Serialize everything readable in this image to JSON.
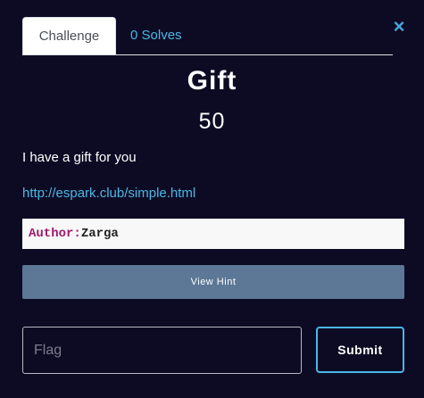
{
  "close_icon": "×",
  "tabs": [
    {
      "label": "Challenge",
      "active": true
    },
    {
      "label": "0 Solves",
      "active": false
    }
  ],
  "challenge": {
    "name": "Gift",
    "value": "50",
    "description": "I have a gift for you",
    "link": "http://espark.club/simple.html",
    "author_key": "Author:",
    "author_value": "Zarga"
  },
  "hint_button": "View Hint",
  "flag_input": {
    "placeholder": "Flag",
    "value": ""
  },
  "submit_button": "Submit",
  "colors": {
    "background": "#0d0b24",
    "accent": "#4ab7e6",
    "hint_button": "#5c7896",
    "author_key": "#a0196a"
  }
}
